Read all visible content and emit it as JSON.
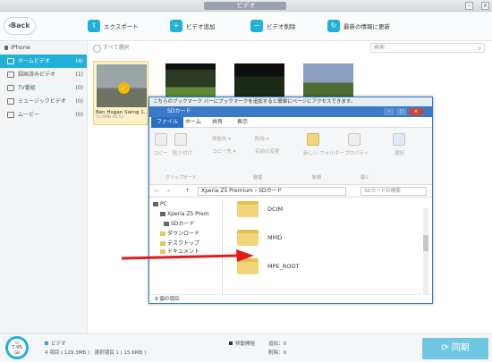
{
  "window": {
    "title": "ビデオ"
  },
  "toolbar": {
    "back_label": "Back",
    "export_label": "エクスポート",
    "add_label": "ビデオ追加",
    "delete_label": "ビデオ削除",
    "refresh_label": "最新の情報に更新"
  },
  "sidebar": {
    "device": "iPhone",
    "items": [
      {
        "label": "ホームビデオ",
        "count": "(4)"
      },
      {
        "label": "録画済みビデオ",
        "count": "(1)"
      },
      {
        "label": "TV番組",
        "count": "(0)"
      },
      {
        "label": "ミュージックビデオ",
        "count": "(0)"
      },
      {
        "label": "ムービー",
        "count": "(0)"
      }
    ]
  },
  "main": {
    "select_all": "すべて選択",
    "search_placeholder": "検索",
    "videos": [
      {
        "caption": "Ben Hogan Swing 1...",
        "meta": "15.6MB    00:52"
      }
    ]
  },
  "explorer": {
    "bookmark_bar": "こちらのブックマーク バーにブックマークを追加すると簡単にページにアクセスできます。",
    "title": "SDカード",
    "tabs": [
      "ファイル",
      "ホーム",
      "共有",
      "表示"
    ],
    "ribbon": {
      "copy": "コピー",
      "paste": "貼り付け",
      "move_to": "移動先 ▾",
      "copy_to": "コピー先 ▾",
      "delete": "削除 ▾",
      "rename": "名前の変更",
      "new_folder": "新しい\nフォルダー",
      "properties": "プロパティ",
      "open": "開く",
      "select": "選択",
      "group_clipboard": "クリップボード",
      "group_organize": "整理",
      "group_new": "新規",
      "group_open": "開く"
    },
    "address": "Xperia Z5 Premium  ›  SDカード",
    "search_placeholder": "SDカードの検索",
    "nav": [
      "PC",
      "Xperia Z5 Prem",
      "SDカード",
      "ダウンロード",
      "デスクトップ",
      "ドキュメント"
    ],
    "folders": [
      "DCIM",
      "MMD",
      "MPE_ROOT"
    ],
    "status": "9 個の項目"
  },
  "bottom": {
    "storage_label": "SD",
    "storage_value": "7.95",
    "storage_unit": "GB",
    "video_label": "ビデオ",
    "video_detail": "4 項目 ( 129.3MB )",
    "selected_detail": "選択項目 1 ( 15.6MB )",
    "sync_pending": "移動開始",
    "pending_detail": "追加：0",
    "deleted_detail": "削除：0",
    "sync_label": "同期"
  },
  "colors": {
    "accent": "#21b0d7",
    "arrow": "#e11b1b",
    "selected": "#fdf1c6"
  }
}
